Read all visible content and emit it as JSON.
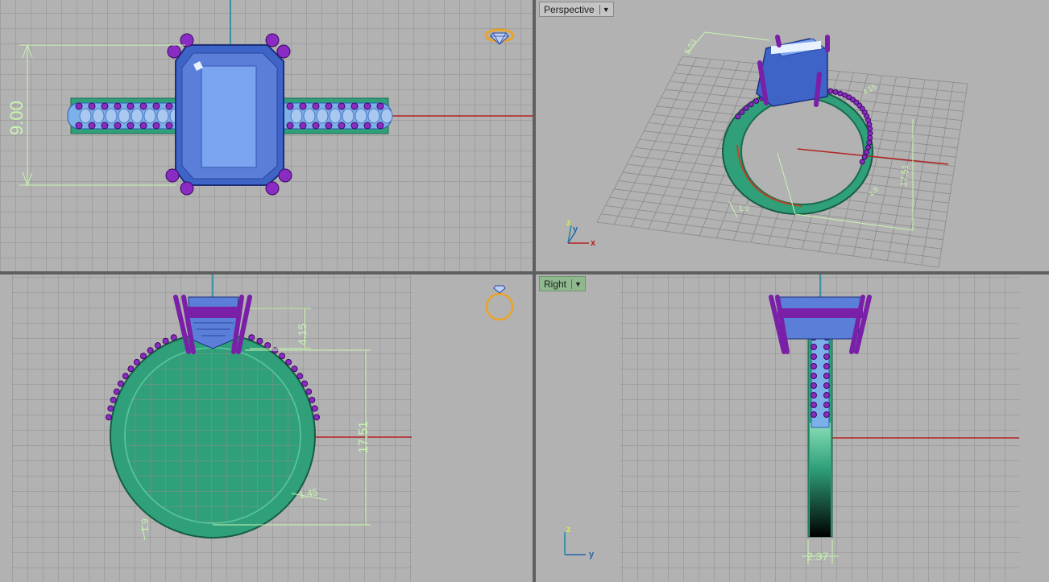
{
  "viewports": {
    "top": {
      "dim_height": "9.00"
    },
    "perspective": {
      "label": "Perspective",
      "dims": [
        "5.53",
        "17.51",
        "4.15",
        "1.0",
        "1.9"
      ],
      "axes": {
        "x": "x",
        "y": "y",
        "z": "z"
      }
    },
    "front": {
      "dims": {
        "prong_height": "4.15",
        "inner_diameter": "17.51",
        "shank_width": "1.45",
        "thickness": "1.9"
      }
    },
    "right": {
      "label": "Right",
      "dim_band_width": "2.37",
      "axes": {
        "y": "y",
        "z": "z"
      }
    }
  },
  "colors": {
    "grid_bg": "#b2b2b2",
    "gem": "#6a8fe6",
    "metal_green": "#2fa07a",
    "prong_purple": "#7a1fa8",
    "dimension": "#c8f5b0",
    "x_axis": "#b32222",
    "y_axis": "#1a8aa0",
    "active_label": "#8fb88f"
  },
  "icons": [
    "diamond-gizmo-icon",
    "ring-gizmo-icon"
  ]
}
